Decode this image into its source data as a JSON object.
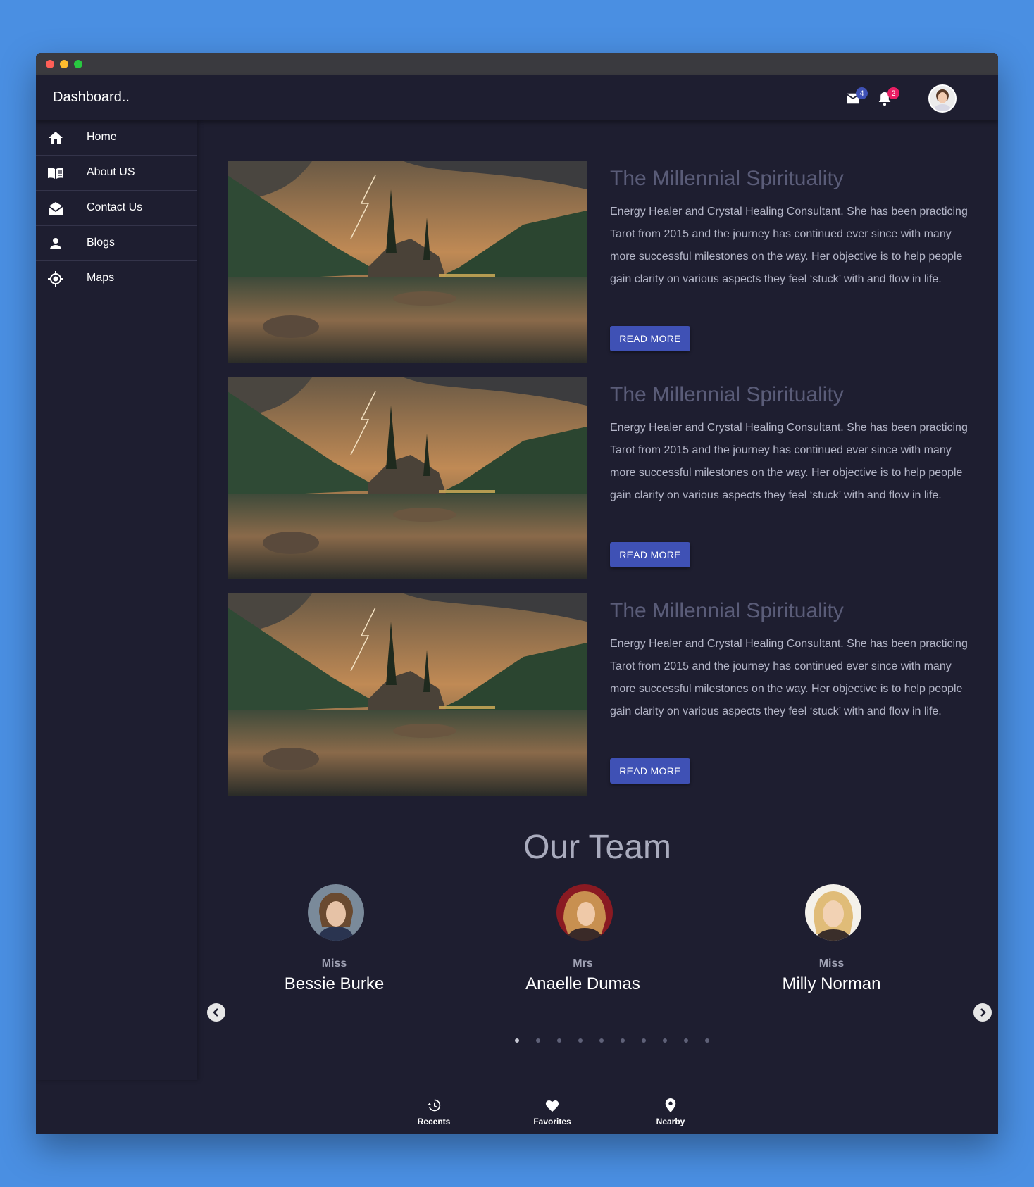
{
  "app": {
    "title": "Dashboard.."
  },
  "header": {
    "mail_count": "4",
    "notification_count": "2",
    "mail_badge_color": "#3f51b5",
    "notification_badge_color": "#e91e63"
  },
  "sidebar": {
    "items": [
      {
        "label": "Home",
        "icon": "home-icon"
      },
      {
        "label": "About US",
        "icon": "book-icon"
      },
      {
        "label": "Contact Us",
        "icon": "mail-open-icon"
      },
      {
        "label": "Blogs",
        "icon": "person-icon"
      },
      {
        "label": "Maps",
        "icon": "location-target-icon"
      }
    ]
  },
  "posts": [
    {
      "title": "The Millennial Spirituality",
      "text": "Energy Healer and Crystal Healing Consultant. She has been practicing Tarot from 2015 and the journey has continued ever since with many more successful milestones on the way. Her objective is to help people gain clarity on various aspects they feel ‘stuck’ with and flow in life.",
      "button": "READ MORE"
    },
    {
      "title": "The Millennial Spirituality",
      "text": "Energy Healer and Crystal Healing Consultant. She has been practicing Tarot from 2015 and the journey has continued ever since with many more successful milestones on the way. Her objective is to help people gain clarity on various aspects they feel ‘stuck’ with and flow in life.",
      "button": "READ MORE"
    },
    {
      "title": "The Millennial Spirituality",
      "text": "Energy Healer and Crystal Healing Consultant. She has been practicing Tarot from 2015 and the journey has continued ever since with many more successful milestones on the way. Her objective is to help people gain clarity on various aspects they feel ‘stuck’ with and flow in life.",
      "button": "READ MORE"
    }
  ],
  "team": {
    "title": "Our Team",
    "members": [
      {
        "salutation": "Miss",
        "name": "Bessie Burke"
      },
      {
        "salutation": "Mrs",
        "name": "Anaelle Dumas"
      },
      {
        "salutation": "Miss",
        "name": "Milly Norman"
      }
    ],
    "active_slide": 1,
    "slide_count": 10
  },
  "bottom_nav": [
    {
      "label": "Recents",
      "icon": "history-icon"
    },
    {
      "label": "Favorites",
      "icon": "heart-icon"
    },
    {
      "label": "Nearby",
      "icon": "location-pin-icon"
    }
  ]
}
